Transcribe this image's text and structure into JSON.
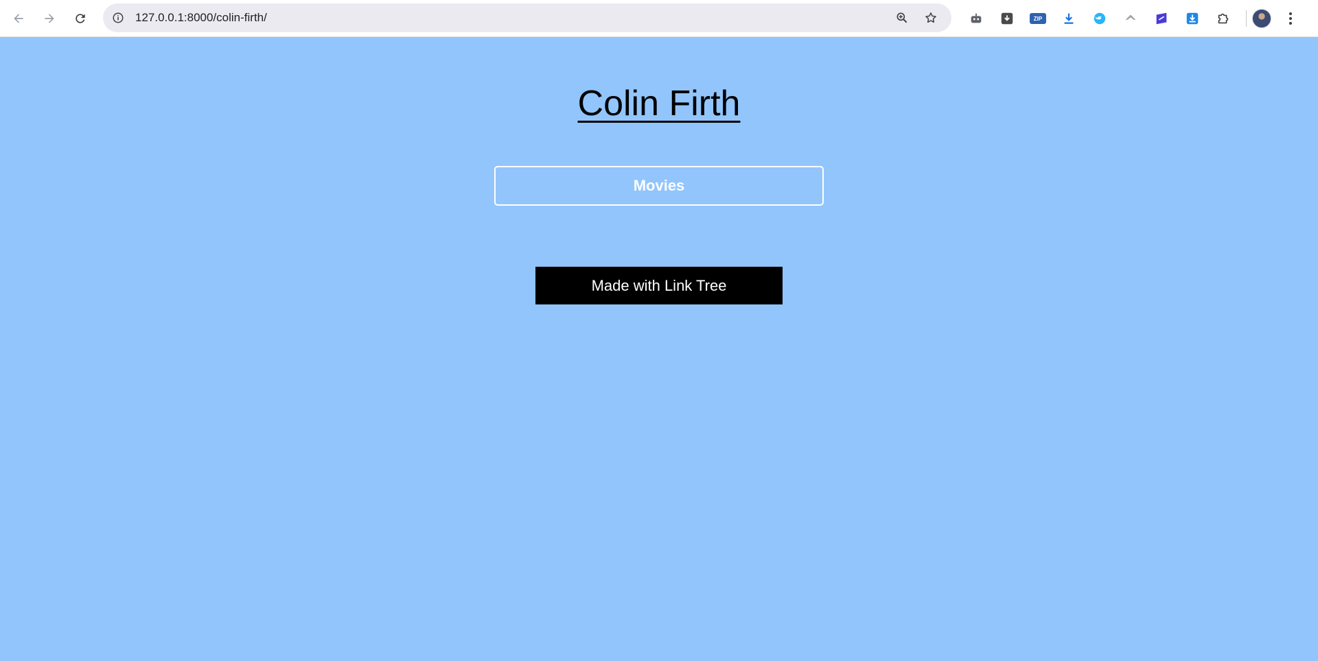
{
  "browser": {
    "url": "127.0.0.1:8000/colin-firth/",
    "extensions": [
      {
        "name": "robot-extension-icon",
        "label": "",
        "color": "#5f6368"
      },
      {
        "name": "download-box-extension-icon",
        "label": "",
        "color": "#4a4a4a"
      },
      {
        "name": "zip-extension-icon",
        "label": "ZIP",
        "color": "#2f62b0"
      },
      {
        "name": "download-arrow-extension-icon",
        "label": "",
        "color": "#1a73e8"
      },
      {
        "name": "bird-extension-icon",
        "label": "",
        "color": "#29b6f6"
      },
      {
        "name": "airplane-extension-icon",
        "label": "",
        "color": "#9e9e9e"
      },
      {
        "name": "note-extension-icon",
        "label": "",
        "color": "#4b3bd6"
      },
      {
        "name": "download-square-extension-icon",
        "label": "",
        "color": "#1e88e5"
      },
      {
        "name": "puzzle-extensions-icon",
        "label": "",
        "color": "#3c4043"
      }
    ]
  },
  "page": {
    "title": "Colin Firth",
    "links": [
      {
        "label": "Movies"
      }
    ],
    "footer_label": "Made with Link Tree",
    "colors": {
      "background": "#92c5fc",
      "footer_bg": "#000000",
      "link_border": "#ffffff"
    }
  }
}
